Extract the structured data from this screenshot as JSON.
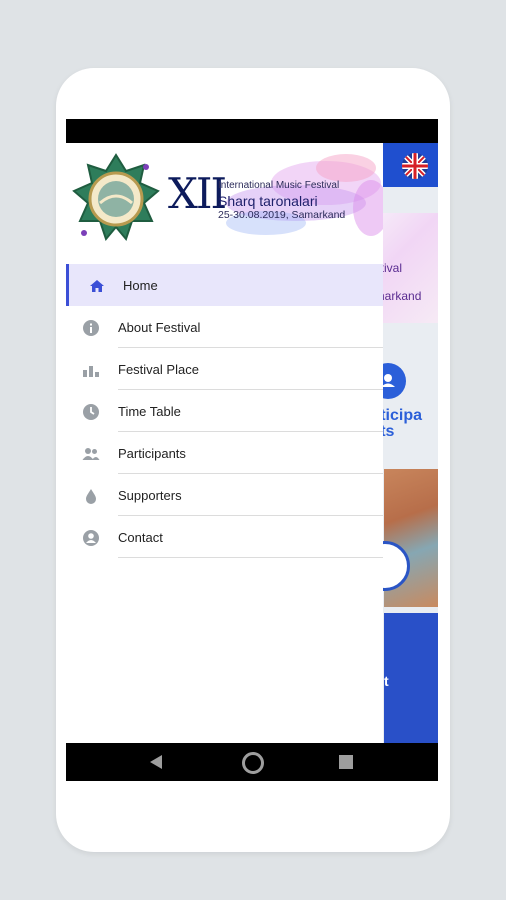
{
  "festival_header": {
    "numeral": "XII",
    "subtitle": "International Music Festival",
    "title": "Sharq taronalari",
    "dates_place": "25-30.08.2019, Samarkand"
  },
  "menu": {
    "items": [
      {
        "label": "Home",
        "icon": "home-icon",
        "active": true
      },
      {
        "label": "About Festival",
        "icon": "info-icon",
        "active": false
      },
      {
        "label": "Festival Place",
        "icon": "bar-chart-icon",
        "active": false
      },
      {
        "label": "Time Table",
        "icon": "clock-icon",
        "active": false
      },
      {
        "label": "Participants",
        "icon": "people-icon",
        "active": false
      },
      {
        "label": "Supporters",
        "icon": "drop-icon",
        "active": false
      },
      {
        "label": "Contact",
        "icon": "account-icon",
        "active": false
      }
    ]
  },
  "background_app": {
    "banner_partial": "estival\nl\namarkand",
    "participants_partial": "ticipa\nts",
    "bottom_partial": "t"
  },
  "colors": {
    "accent": "#2b5fd9",
    "active_bg": "#e8e6fb",
    "icon_active": "#3b4fd6",
    "icon_inactive": "#9aa0a6"
  }
}
